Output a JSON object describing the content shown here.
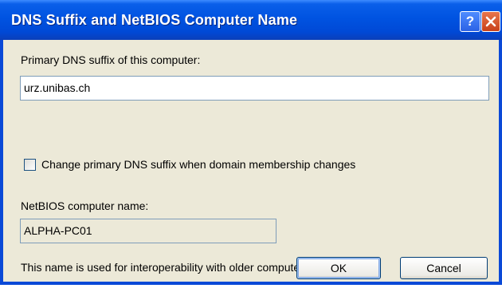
{
  "dialog": {
    "title": "DNS Suffix and NetBIOS Computer Name",
    "help_glyph": "?",
    "primary_dns_label": "Primary DNS suffix of this computer:",
    "primary_dns_value": "urz.unibas.ch",
    "checkbox_label": "Change primary DNS suffix when domain membership changes",
    "checkbox_checked": false,
    "netbios_label": "NetBIOS computer name:",
    "netbios_value": "ALPHA-PC01",
    "info_text": "This name is used for interoperability with older computers and services.",
    "ok_label": "OK",
    "cancel_label": "Cancel"
  },
  "colors": {
    "titlebar": "#0053e1",
    "dialog_bg": "#ece9d8",
    "close_button": "#d9532a"
  }
}
